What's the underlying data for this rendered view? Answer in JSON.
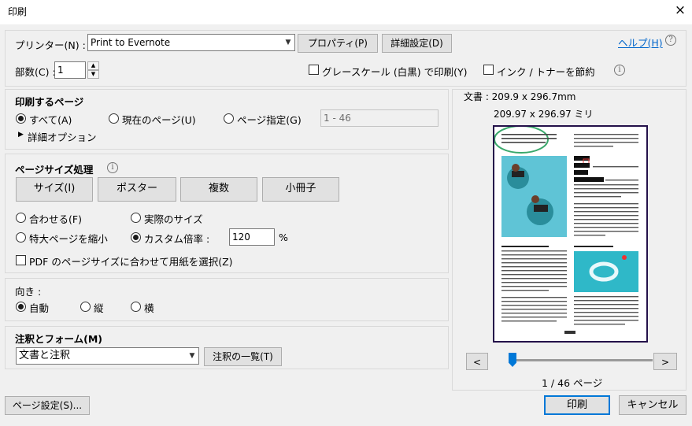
{
  "window": {
    "title": "印刷",
    "close_icon": "×"
  },
  "printer": {
    "label": "プリンター(N) :",
    "selected": "Print to Evernote",
    "properties_button": "プロパティ(P)",
    "advanced_button": "詳細設定(D)",
    "help_link": "ヘルプ(H)"
  },
  "copies": {
    "label": "部数(C) :",
    "value": "1"
  },
  "options": {
    "grayscale_label": "グレースケール (白黒) で印刷(Y)",
    "grayscale_checked": false,
    "save_ink_label": "インク / トナーを節約",
    "save_ink_checked": false
  },
  "pages_to_print": {
    "heading": "印刷するページ",
    "all_label": "すべて(A)",
    "current_label": "現在のページ(U)",
    "range_label": "ページ指定(G)",
    "range_value": "1 - 46",
    "selected": "all",
    "more_options_label": "詳細オプション"
  },
  "page_sizing": {
    "heading": "ページサイズ処理",
    "tabs": [
      "サイズ(I)",
      "ポスター",
      "複数",
      "小冊子"
    ],
    "fit_label": "合わせる(F)",
    "actual_label": "実際のサイズ",
    "shrink_label": "特大ページを縮小",
    "custom_label": "カスタム倍率 :",
    "custom_value": "120",
    "percent_sign": "%",
    "selected": "custom",
    "pdf_size_label": "PDF のページサイズに合わせて用紙を選択(Z)",
    "pdf_size_checked": false
  },
  "orientation": {
    "heading": "向き :",
    "auto_label": "自動",
    "portrait_label": "縦",
    "landscape_label": "横",
    "selected": "auto"
  },
  "comments": {
    "heading": "注釈とフォーム(M)",
    "selected": "文書と注釈",
    "summarize_button": "注釈の一覧(T)"
  },
  "preview": {
    "doc_size": "文書 : 209.9 x 296.7mm",
    "paper_size": "209.97 x 296.97 ミリ",
    "prev_button": "<",
    "next_button": ">",
    "page_indicator": "1 / 46 ページ",
    "slider_position": 0,
    "section1_heading": "Social and Recreational Aspects",
    "section2_heading": "Health and Hygiene",
    "footer_mark": "ʃʃʃʃʃʃ"
  },
  "footer": {
    "page_setup_button": "ページ設定(S)...",
    "print_button": "印刷",
    "cancel_button": "キャンセル"
  }
}
